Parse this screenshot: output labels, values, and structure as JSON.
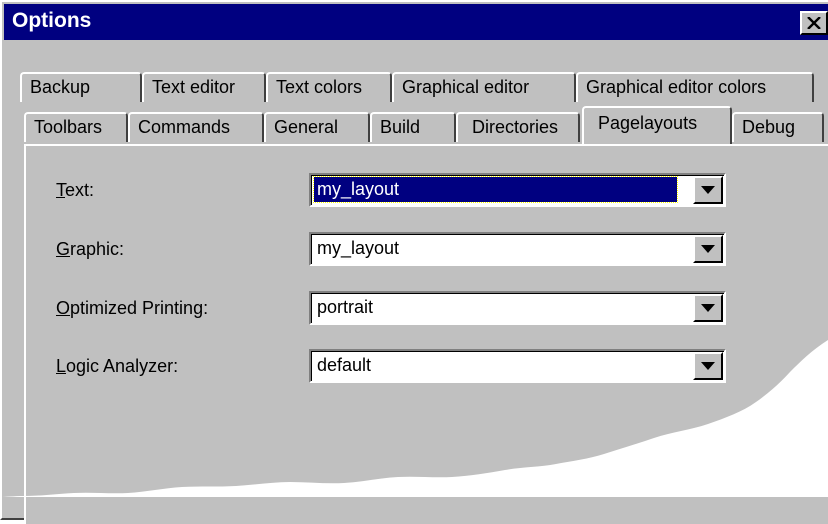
{
  "window": {
    "title": "Options",
    "close_icon": "close-icon"
  },
  "tabs": {
    "row1": [
      "Backup",
      "Text editor",
      "Text colors",
      "Graphical editor",
      "Graphical editor colors"
    ],
    "row2": [
      "Toolbars",
      "Commands",
      "General",
      "Build",
      "Directories",
      "Pagelayouts",
      "Debug"
    ],
    "active": "Pagelayouts"
  },
  "fields": [
    {
      "accel": "T",
      "rest": "ext:",
      "value": "my_layout",
      "selected": true
    },
    {
      "accel": "G",
      "rest": "raphic:",
      "value": "my_layout",
      "selected": false
    },
    {
      "accel": "O",
      "rest": "ptimized Printing:",
      "value": "portrait",
      "selected": false
    },
    {
      "accel": "L",
      "rest": "ogic Analyzer:",
      "value": "default",
      "selected": false
    }
  ],
  "colors": {
    "titlebar": "#000080",
    "face": "#c0c0c0",
    "selection": "#000080"
  }
}
